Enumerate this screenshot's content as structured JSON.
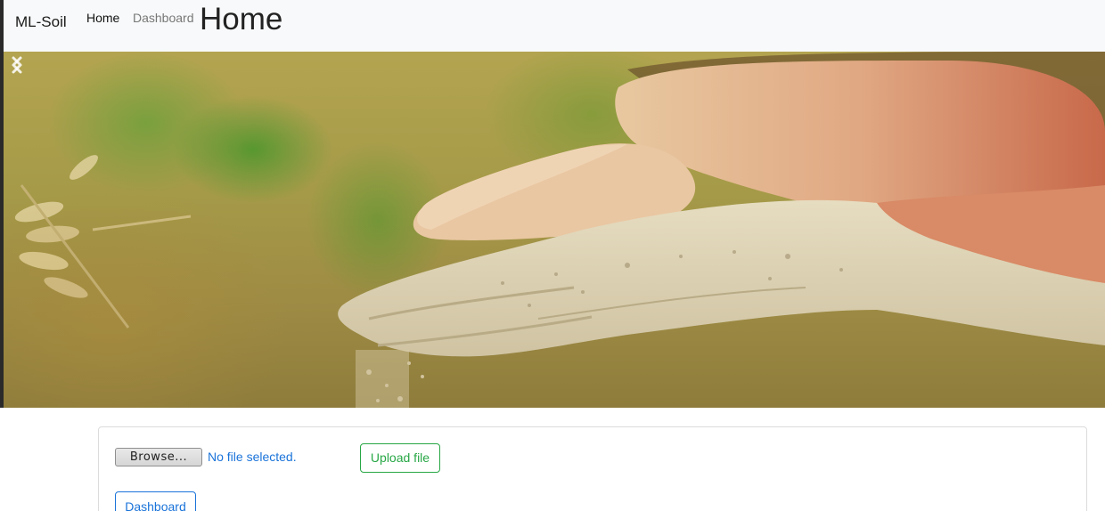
{
  "navbar": {
    "brand": "ML-Soil",
    "links": [
      {
        "label": "Home",
        "active": true
      },
      {
        "label": "Dashboard",
        "active": false
      }
    ],
    "heading": "Home"
  },
  "carousel": {
    "image": "soil-in-hand-photo",
    "prev_icon": "chevron-left-icon",
    "next_icon": "chevron-right-icon"
  },
  "upload": {
    "browse_label": "Browse...",
    "file_status": "No file selected.",
    "upload_label": "Upload file",
    "dashboard_label": "Dashboard"
  },
  "colors": {
    "navbar_bg": "#f8f9fa",
    "success": "#28a745",
    "primary": "#1a73d9"
  }
}
